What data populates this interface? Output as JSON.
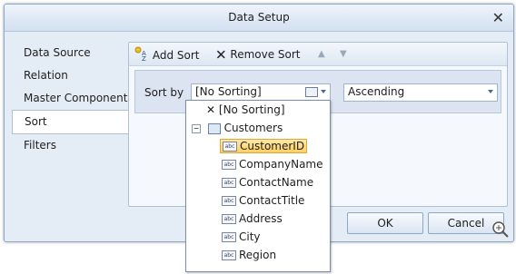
{
  "window": {
    "title": "Data Setup"
  },
  "sidebar": {
    "items": [
      {
        "label": "Data Source"
      },
      {
        "label": "Relation"
      },
      {
        "label": "Master Component"
      },
      {
        "label": "Sort",
        "selected": true
      },
      {
        "label": "Filters"
      }
    ]
  },
  "toolbar": {
    "add_sort": "Add Sort",
    "remove_sort": "Remove Sort"
  },
  "sort": {
    "label": "Sort by",
    "field_value": "[No Sorting]",
    "direction_value": "Ascending"
  },
  "popup": {
    "no_sorting": "[No Sorting]",
    "group": "Customers",
    "fields": [
      "CustomerID",
      "CompanyName",
      "ContactName",
      "ContactTitle",
      "Address",
      "City",
      "Region"
    ],
    "selected_field": "CustomerID"
  },
  "buttons": {
    "ok": "OK",
    "cancel": "Cancel"
  },
  "colors": {
    "selection_fill": "#ffcf5e",
    "dialog_bg": "#e4ecf6"
  }
}
